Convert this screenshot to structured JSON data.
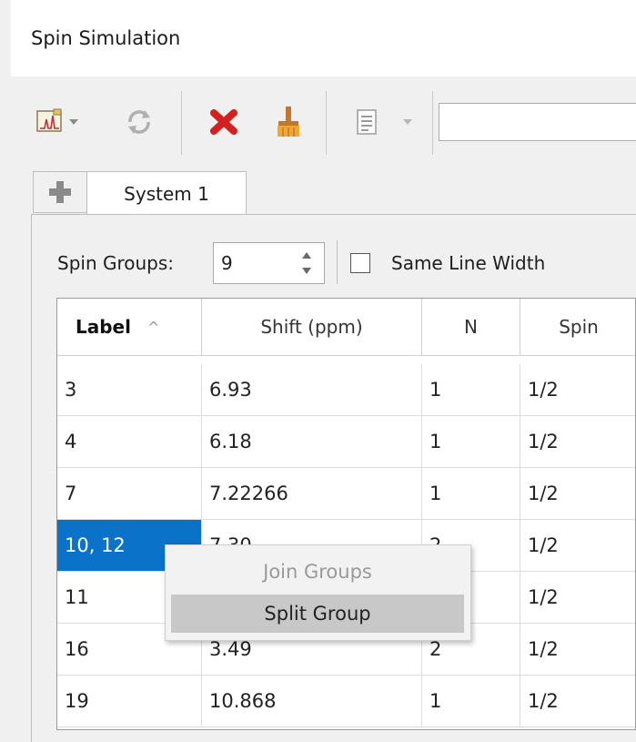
{
  "window": {
    "title": "Spin Simulation"
  },
  "toolbar": {
    "icons": [
      "spectrum-icon",
      "refresh-icon",
      "delete-icon",
      "clear-icon",
      "list-icon"
    ],
    "search_value": ""
  },
  "tabs": {
    "add_icon": "plus-icon",
    "active_label": "System 1"
  },
  "controls": {
    "spin_groups_label": "Spin Groups:",
    "spin_groups_value": "9",
    "same_line_width_label": "Same Line Width",
    "same_line_width_checked": false
  },
  "table": {
    "columns": [
      "Label",
      "Shift (ppm)",
      "N",
      "Spin"
    ],
    "sort_indicator": "^",
    "rows": [
      {
        "label": "3",
        "shift": "6.93",
        "n": "1",
        "spin": "1/2"
      },
      {
        "label": "4",
        "shift": "6.18",
        "n": "1",
        "spin": "1/2"
      },
      {
        "label": "7",
        "shift": "7.22266",
        "n": "1",
        "spin": "1/2"
      },
      {
        "label": "10, 12",
        "shift": "7.30",
        "n": "2",
        "spin": "1/2"
      },
      {
        "label": "11",
        "shift": "",
        "n": "",
        "spin": "1/2"
      },
      {
        "label": "16",
        "shift": "3.49",
        "n": "2",
        "spin": "1/2"
      },
      {
        "label": "19",
        "shift": "10.868",
        "n": "1",
        "spin": "1/2"
      }
    ],
    "selected_row": 3
  },
  "context_menu": {
    "items": [
      "Join Groups",
      "Split Group"
    ],
    "disabled_item": "Join Groups",
    "hover_item": "Split Group"
  },
  "colors": {
    "selection": "#0a72c9",
    "delete": "#d42020",
    "clear": "#e09a20"
  }
}
